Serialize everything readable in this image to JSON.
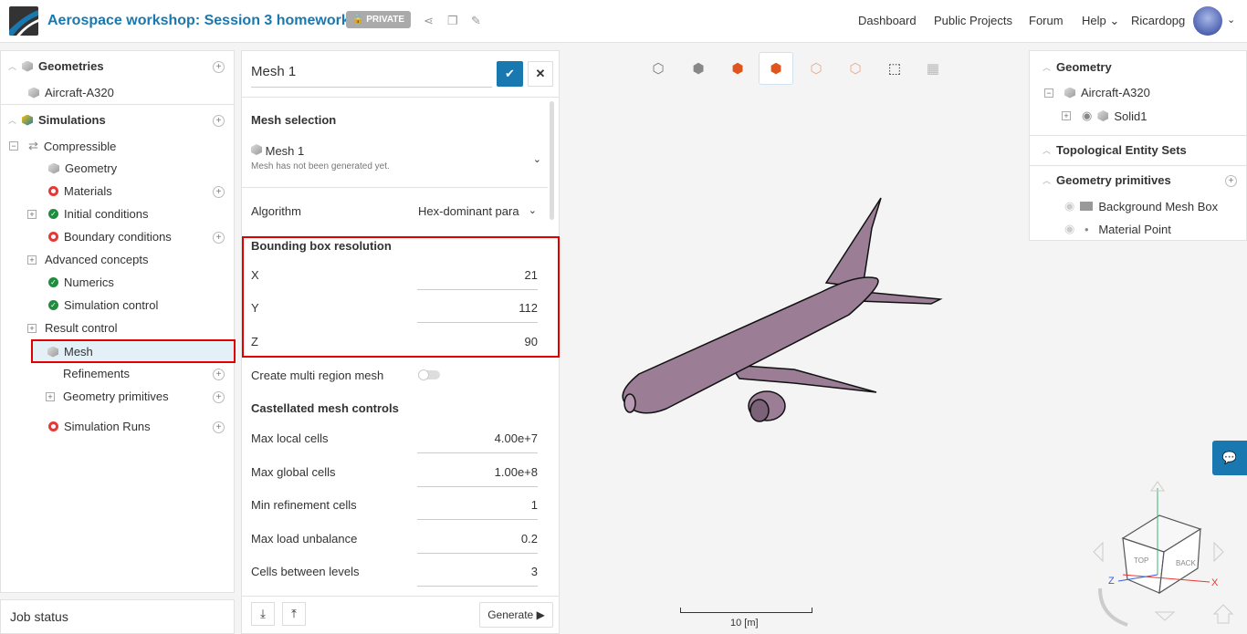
{
  "header": {
    "title": "Aerospace workshop: Session 3 homework",
    "private_badge": "PRIVATE",
    "nav": [
      "Dashboard",
      "Public Projects",
      "Forum",
      "Help"
    ],
    "user": "Ricardopg"
  },
  "tree": {
    "geometries": "Geometries",
    "geometry_item": "Aircraft-A320",
    "simulations": "Simulations",
    "compressible": "Compressible",
    "items": [
      "Geometry",
      "Materials",
      "Initial conditions",
      "Boundary conditions",
      "Advanced concepts",
      "Numerics",
      "Simulation control",
      "Result control",
      "Mesh",
      "Refinements",
      "Geometry primitives",
      "Simulation Runs"
    ]
  },
  "job_status": "Job status",
  "mesh_panel": {
    "name": "Mesh 1",
    "mesh_selection": "Mesh selection",
    "mesh_name": "Mesh 1",
    "mesh_status": "Mesh has not been generated yet.",
    "algorithm_label": "Algorithm",
    "algorithm_value": "Hex-dominant para",
    "bbox_title": "Bounding box resolution",
    "x_label": "X",
    "x": "21",
    "y_label": "Y",
    "y": "112",
    "z_label": "Z",
    "z": "90",
    "multi_region": "Create multi region mesh",
    "multi_region_on": false,
    "castellated": "Castellated mesh controls",
    "rows": [
      {
        "label": "Max local cells",
        "value": "4.00e+7"
      },
      {
        "label": "Max global cells",
        "value": "1.00e+8"
      },
      {
        "label": "Min refinement cells",
        "value": "1"
      },
      {
        "label": "Max load unbalance",
        "value": "0.2"
      },
      {
        "label": "Cells between levels",
        "value": "3"
      }
    ],
    "generate": "Generate"
  },
  "right_panel": {
    "geometry": "Geometry",
    "aircraft": "Aircraft-A320",
    "solid": "Solid1",
    "topo": "Topological Entity Sets",
    "primitives": "Geometry primitives",
    "bg_box": "Background Mesh Box",
    "material_point": "Material Point"
  },
  "viewport": {
    "scale": "10 [m]",
    "cube_top": "TOP",
    "cube_back": "BACK",
    "axis_x": "X",
    "axis_z": "Z"
  },
  "colors": {
    "accent": "#1a78b0",
    "ok": "#1e8e3e",
    "error": "#e53935",
    "highlight": "#e00000",
    "plane": "#9b7d96"
  }
}
